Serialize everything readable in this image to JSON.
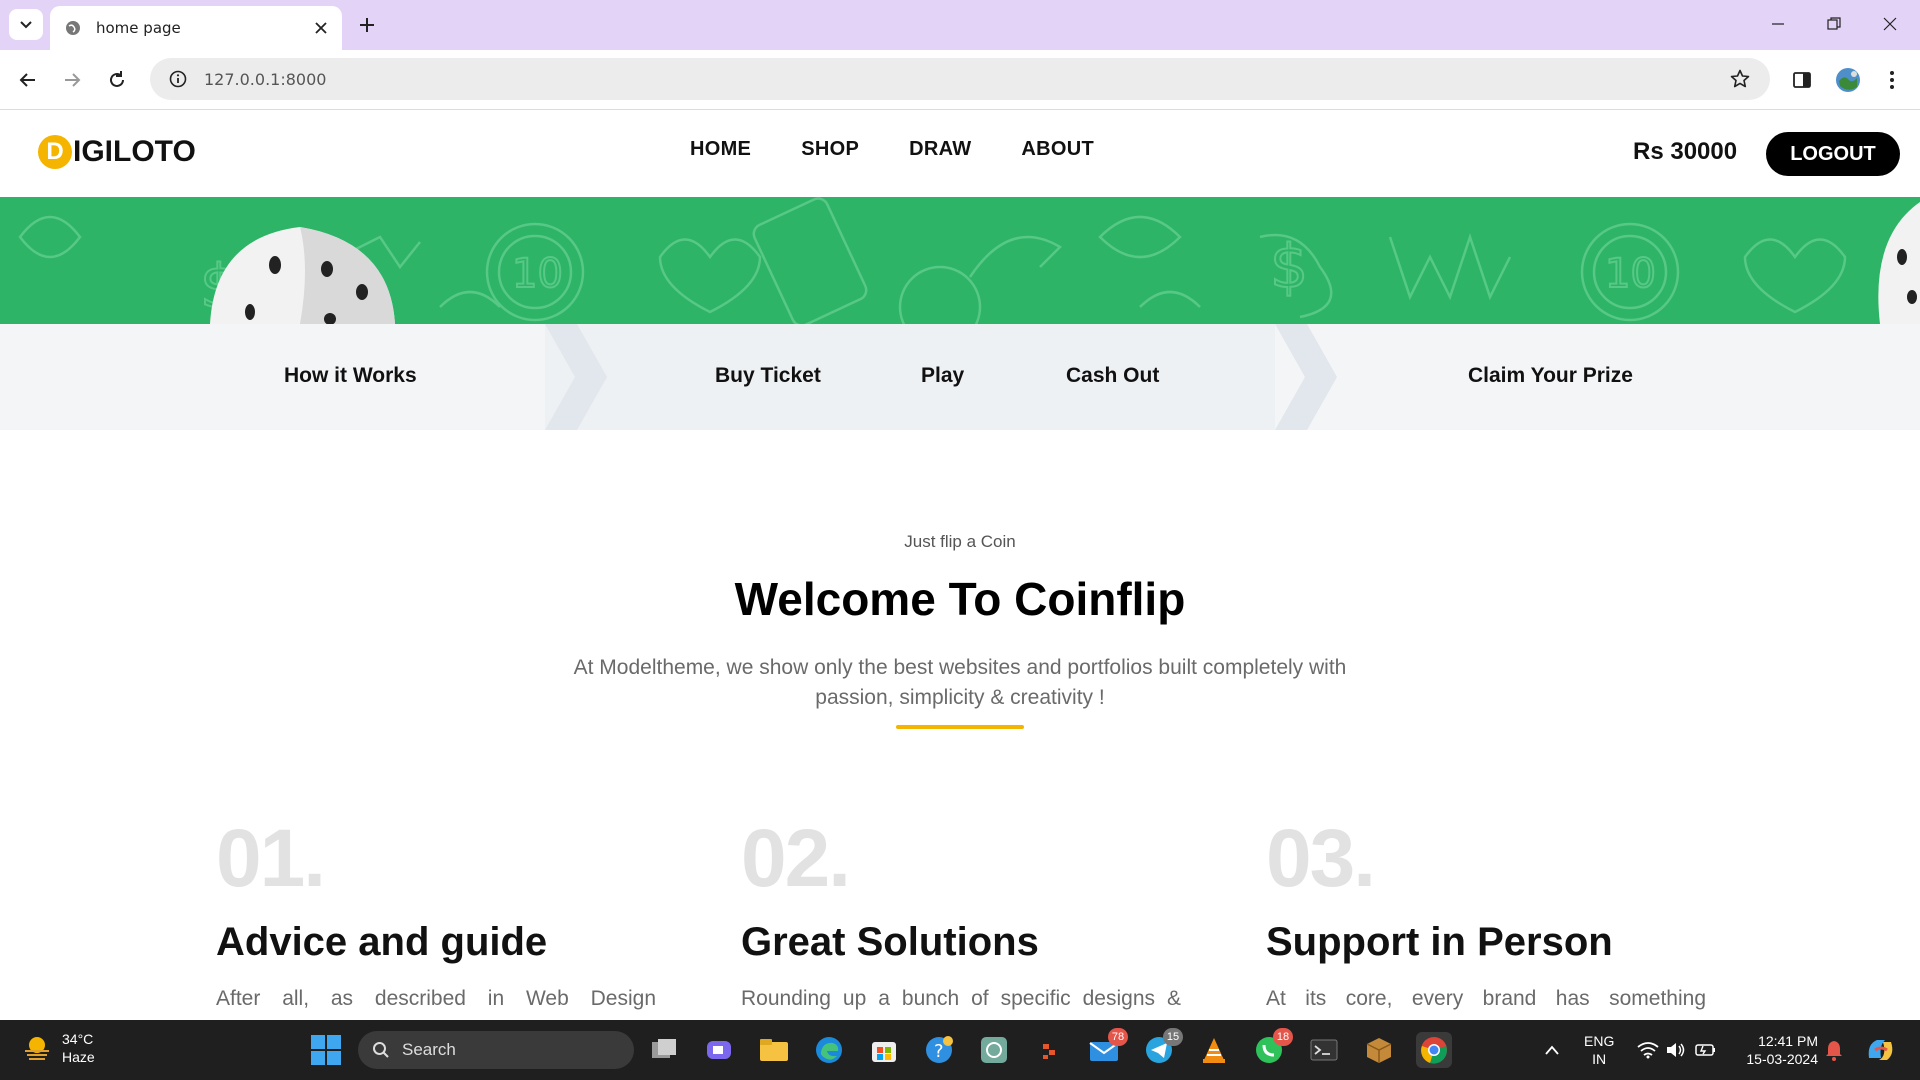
{
  "browser": {
    "tab_title": "home page",
    "url": "127.0.0.1:8000"
  },
  "site": {
    "logo_letter": "D",
    "logo_text": "IGILOTO",
    "nav": [
      "HOME",
      "SHOP",
      "DRAW",
      "ABOUT"
    ],
    "balance": "Rs 30000",
    "logout_label": "LOGOUT"
  },
  "steps": [
    "How it Works",
    "Buy Ticket",
    "Play",
    "Cash Out",
    "Claim Your Prize"
  ],
  "intro": {
    "kicker": "Just flip a Coin",
    "headline": "Welcome To Coinflip",
    "lead": "At Modeltheme, we show only the best websites and portfolios built completely with passion, simplicity & creativity !"
  },
  "features": [
    {
      "num": "01.",
      "title": "Advice and guide",
      "desc": "After all, as described in Web Design"
    },
    {
      "num": "02.",
      "title": "Great Solutions",
      "desc": "Rounding up a bunch of specific designs &"
    },
    {
      "num": "03.",
      "title": "Support in Person",
      "desc": "At its core, every brand has something"
    }
  ],
  "taskbar": {
    "temperature": "34°C",
    "weather": "Haze",
    "search_label": "Search",
    "mail_badge": "78",
    "telegram_badge": "15",
    "whatsapp_badge": "18",
    "lang_top": "ENG",
    "lang_bottom": "IN",
    "time": "12:41 PM",
    "date": "15-03-2024"
  },
  "colors": {
    "accent": "#f5b400",
    "banner": "#2db467",
    "tabstrip": "#e3d4f7"
  }
}
